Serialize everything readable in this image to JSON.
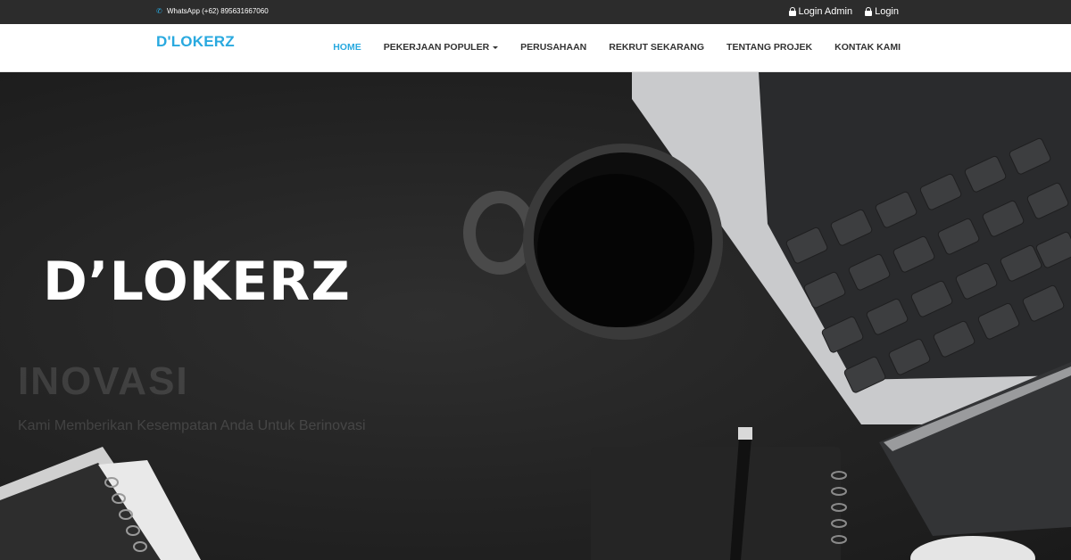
{
  "topbar": {
    "contact_text": "WhatsApp (+62) 895631667060",
    "login_admin": "Login Admin",
    "login": "Login"
  },
  "navbar": {
    "brand": "D'LOKERZ",
    "items": [
      {
        "label": "HOME",
        "active": true
      },
      {
        "label": "PEKERJAAN POPULER",
        "dropdown": true
      },
      {
        "label": "PERUSAHAAN"
      },
      {
        "label": "REKRUT SEKARANG"
      },
      {
        "label": "TENTANG PROJEK"
      },
      {
        "label": "KONTAK KAMI"
      }
    ]
  },
  "hero": {
    "title": "D’LOKERZ",
    "subtitle": "INOVASI",
    "text": "Kami Memberikan Kesempatan Anda Untuk Berinovasi"
  },
  "colors": {
    "accent": "#29a9df",
    "topbar_bg": "#2c2c2c",
    "hero_bg": "#242424"
  }
}
